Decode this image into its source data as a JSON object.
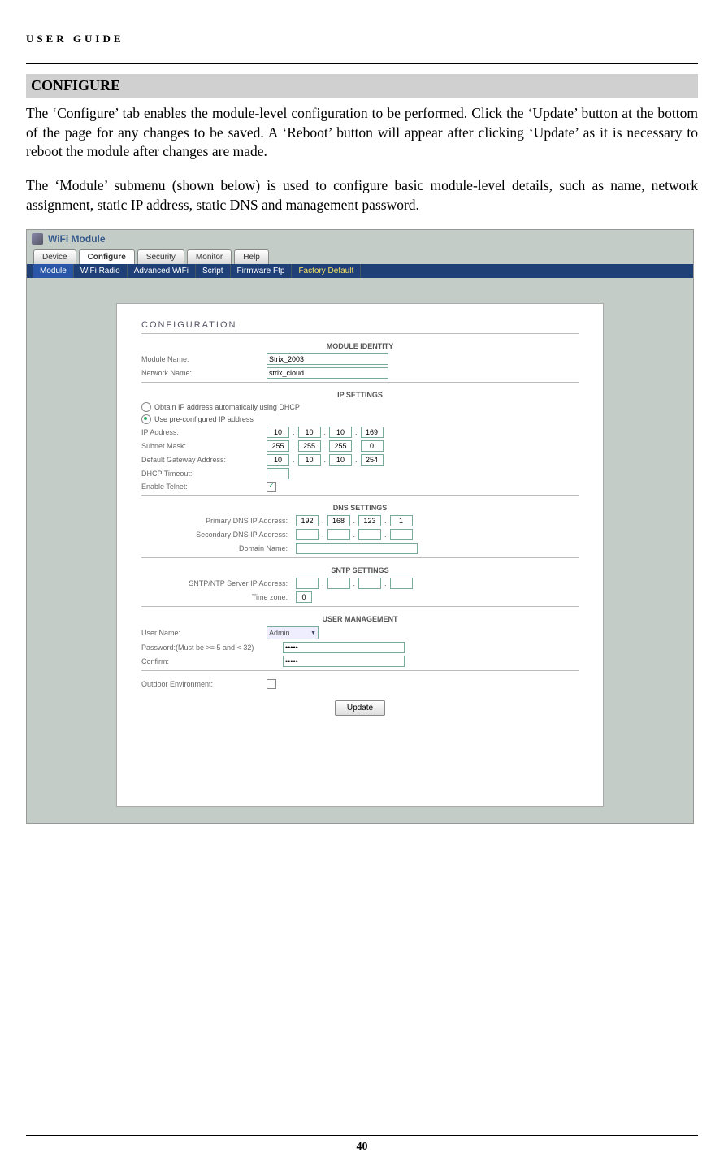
{
  "doc": {
    "header_title": "USER GUIDE",
    "section_title": "CONFIGURE",
    "para1": "The ‘Configure’ tab enables the module-level configuration to be performed. Click the ‘Update’ button at the bottom of the page for any changes to be saved. A ‘Reboot’ button will appear after clicking ‘Update’ as it is necessary to reboot the module after changes are made.",
    "para2": "The ‘Module’ submenu (shown below) is used to configure basic module-level details, such as name, network assignment, static IP address, static DNS and management password.",
    "page_number": "40"
  },
  "ui": {
    "window_title": "WiFi Module",
    "tabs": [
      "Device",
      "Configure",
      "Security",
      "Monitor",
      "Help"
    ],
    "active_tab": "Configure",
    "subtabs": [
      "Module",
      "WiFi Radio",
      "Advanced WiFi",
      "Script",
      "Firmware Ftp",
      "Factory Default"
    ],
    "active_subtab": "Module",
    "pane_title": "CONFIGURATION",
    "identity": {
      "head": "MODULE IDENTITY",
      "module_name_label": "Module Name:",
      "module_name": "Strix_2003",
      "network_name_label": "Network Name:",
      "network_name": "strix_cloud"
    },
    "ip": {
      "head": "IP SETTINGS",
      "radio_dhcp": "Obtain IP address automatically using DHCP",
      "radio_static": "Use pre-configured IP address",
      "selected": "static",
      "addr_label": "IP Address:",
      "addr": [
        "10",
        "10",
        "10",
        "169"
      ],
      "mask_label": "Subnet Mask:",
      "mask": [
        "255",
        "255",
        "255",
        "0"
      ],
      "gw_label": "Default Gateway Address:",
      "gw": [
        "10",
        "10",
        "10",
        "254"
      ],
      "dhcp_to_label": "DHCP Timeout:",
      "dhcp_to": "",
      "telnet_label": "Enable Telnet:",
      "telnet_checked": true
    },
    "dns": {
      "head": "DNS SETTINGS",
      "primary_label": "Primary DNS IP Address:",
      "primary": [
        "192",
        "168",
        "123",
        "1"
      ],
      "secondary_label": "Secondary DNS IP Address:",
      "secondary": [
        "",
        "",
        "",
        ""
      ],
      "domain_label": "Domain Name:",
      "domain": ""
    },
    "sntp": {
      "head": "SNTP SETTINGS",
      "server_label": "SNTP/NTP Server IP Address:",
      "server": [
        "",
        "",
        "",
        ""
      ],
      "tz_label": "Time zone:",
      "tz": "0"
    },
    "user": {
      "head": "USER MANAGEMENT",
      "name_label": "User Name:",
      "name": "Admin",
      "pass_label": "Password:(Must be >= 5 and < 32)",
      "pass": "•••••",
      "confirm_label": "Confirm:",
      "confirm": "•••••"
    },
    "outdoor_label": "Outdoor Environment:",
    "outdoor_checked": false,
    "update_btn": "Update"
  }
}
